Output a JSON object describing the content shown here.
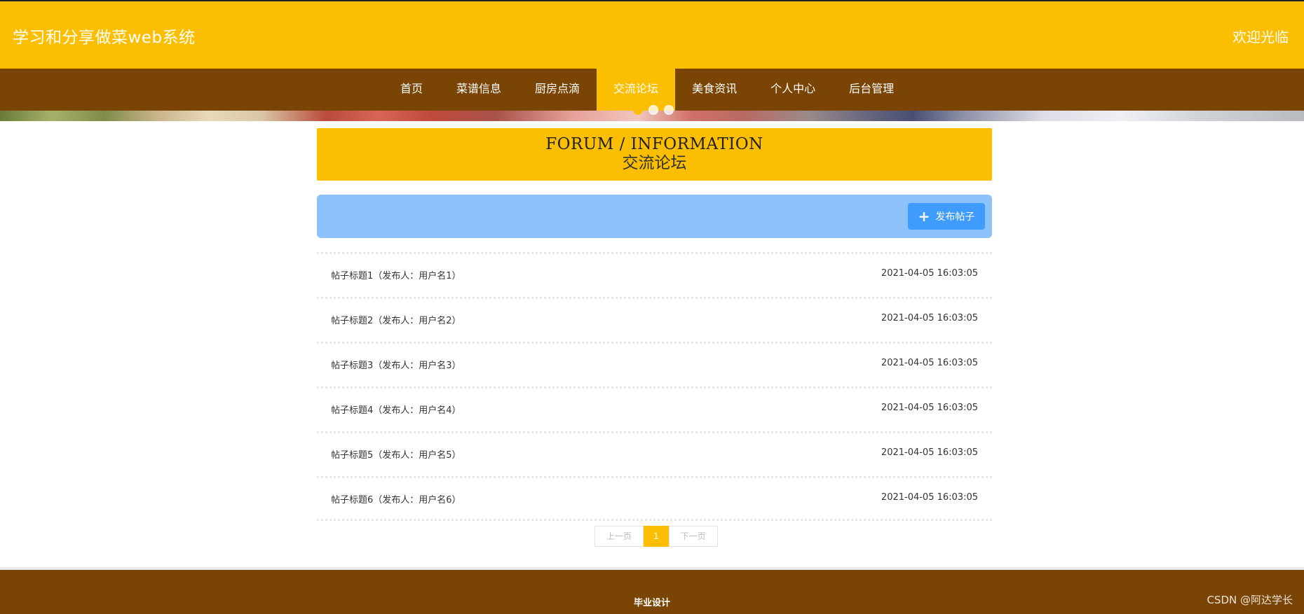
{
  "header": {
    "site_title": "学习和分享做菜web系统",
    "welcome": "欢迎光临"
  },
  "nav": {
    "items": [
      {
        "label": "首页",
        "active": false
      },
      {
        "label": "菜谱信息",
        "active": false
      },
      {
        "label": "厨房点滴",
        "active": false
      },
      {
        "label": "交流论坛",
        "active": true
      },
      {
        "label": "美食资讯",
        "active": false
      },
      {
        "label": "个人中心",
        "active": false
      },
      {
        "label": "后台管理",
        "active": false
      }
    ]
  },
  "banner": {
    "slides": 3,
    "active_slide": 1
  },
  "section": {
    "title_en": "FORUM / INFORMATION",
    "title_cn": "交流论坛"
  },
  "toolbar": {
    "post_button": "发布帖子",
    "post_icon": "plus-icon"
  },
  "posts": [
    {
      "title": "帖子标题1（发布人：用户名1）",
      "time": "2021-04-05 16:03:05"
    },
    {
      "title": "帖子标题2（发布人：用户名2）",
      "time": "2021-04-05 16:03:05"
    },
    {
      "title": "帖子标题3（发布人：用户名3）",
      "time": "2021-04-05 16:03:05"
    },
    {
      "title": "帖子标题4（发布人：用户名4）",
      "time": "2021-04-05 16:03:05"
    },
    {
      "title": "帖子标题5（发布人：用户名5）",
      "time": "2021-04-05 16:03:05"
    },
    {
      "title": "帖子标题6（发布人：用户名6）",
      "time": "2021-04-05 16:03:05"
    }
  ],
  "pager": {
    "prev": "上一页",
    "current": "1",
    "next": "下一页"
  },
  "footer": {
    "text": "毕业设计"
  },
  "watermark": "CSDN @阿达学长",
  "colors": {
    "accent": "#fcbe00",
    "nav_bg": "#7a4404",
    "toolbar_bg": "#8cc2f9",
    "button_bg": "#3f9cfd"
  }
}
